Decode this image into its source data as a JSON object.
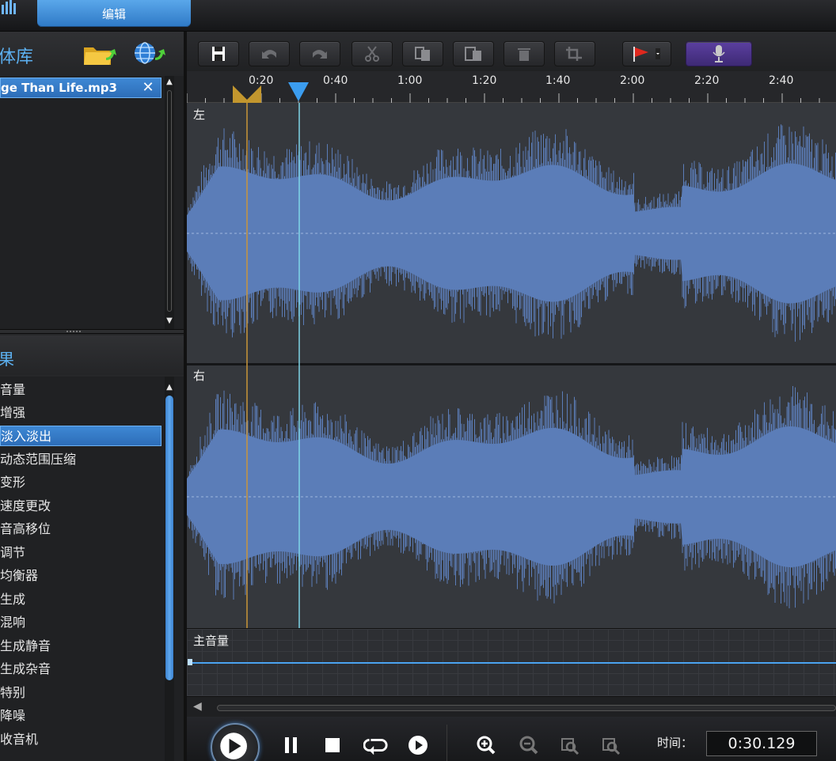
{
  "header": {
    "edit_tab": "编辑"
  },
  "library": {
    "title": "体库",
    "files": [
      {
        "name": "ge Than Life.mp3"
      }
    ],
    "close_glyph": "✕"
  },
  "effects": {
    "title": "果",
    "items": [
      "音量",
      "增强",
      "淡入淡出",
      "动态范围压缩",
      "变形",
      "速度更改",
      "音高移位",
      "调节",
      "均衡器",
      "生成",
      "混响",
      "生成静音",
      "生成杂音",
      "特别",
      "降噪",
      "收音机"
    ],
    "selected_index": 2
  },
  "toolbar": {
    "icons": [
      "save-icon",
      "undo-icon",
      "redo-icon",
      "cut-icon",
      "copy-icon",
      "paste-icon",
      "delete-icon",
      "crop-icon",
      "marker-flag-icon",
      "microphone-icon"
    ]
  },
  "timeline": {
    "ticks": [
      "0:20",
      "0:40",
      "1:00",
      "1:20",
      "1:40",
      "2:00",
      "2:20",
      "2:40"
    ]
  },
  "channels": {
    "left": "左",
    "right": "右"
  },
  "master": {
    "label": "主音量"
  },
  "transport": {
    "time_label": "时间：",
    "time_value": "0:30.129"
  },
  "colors": {
    "accent": "#3d86d2",
    "waveform": "#5b7db8",
    "background": "#35383d"
  }
}
